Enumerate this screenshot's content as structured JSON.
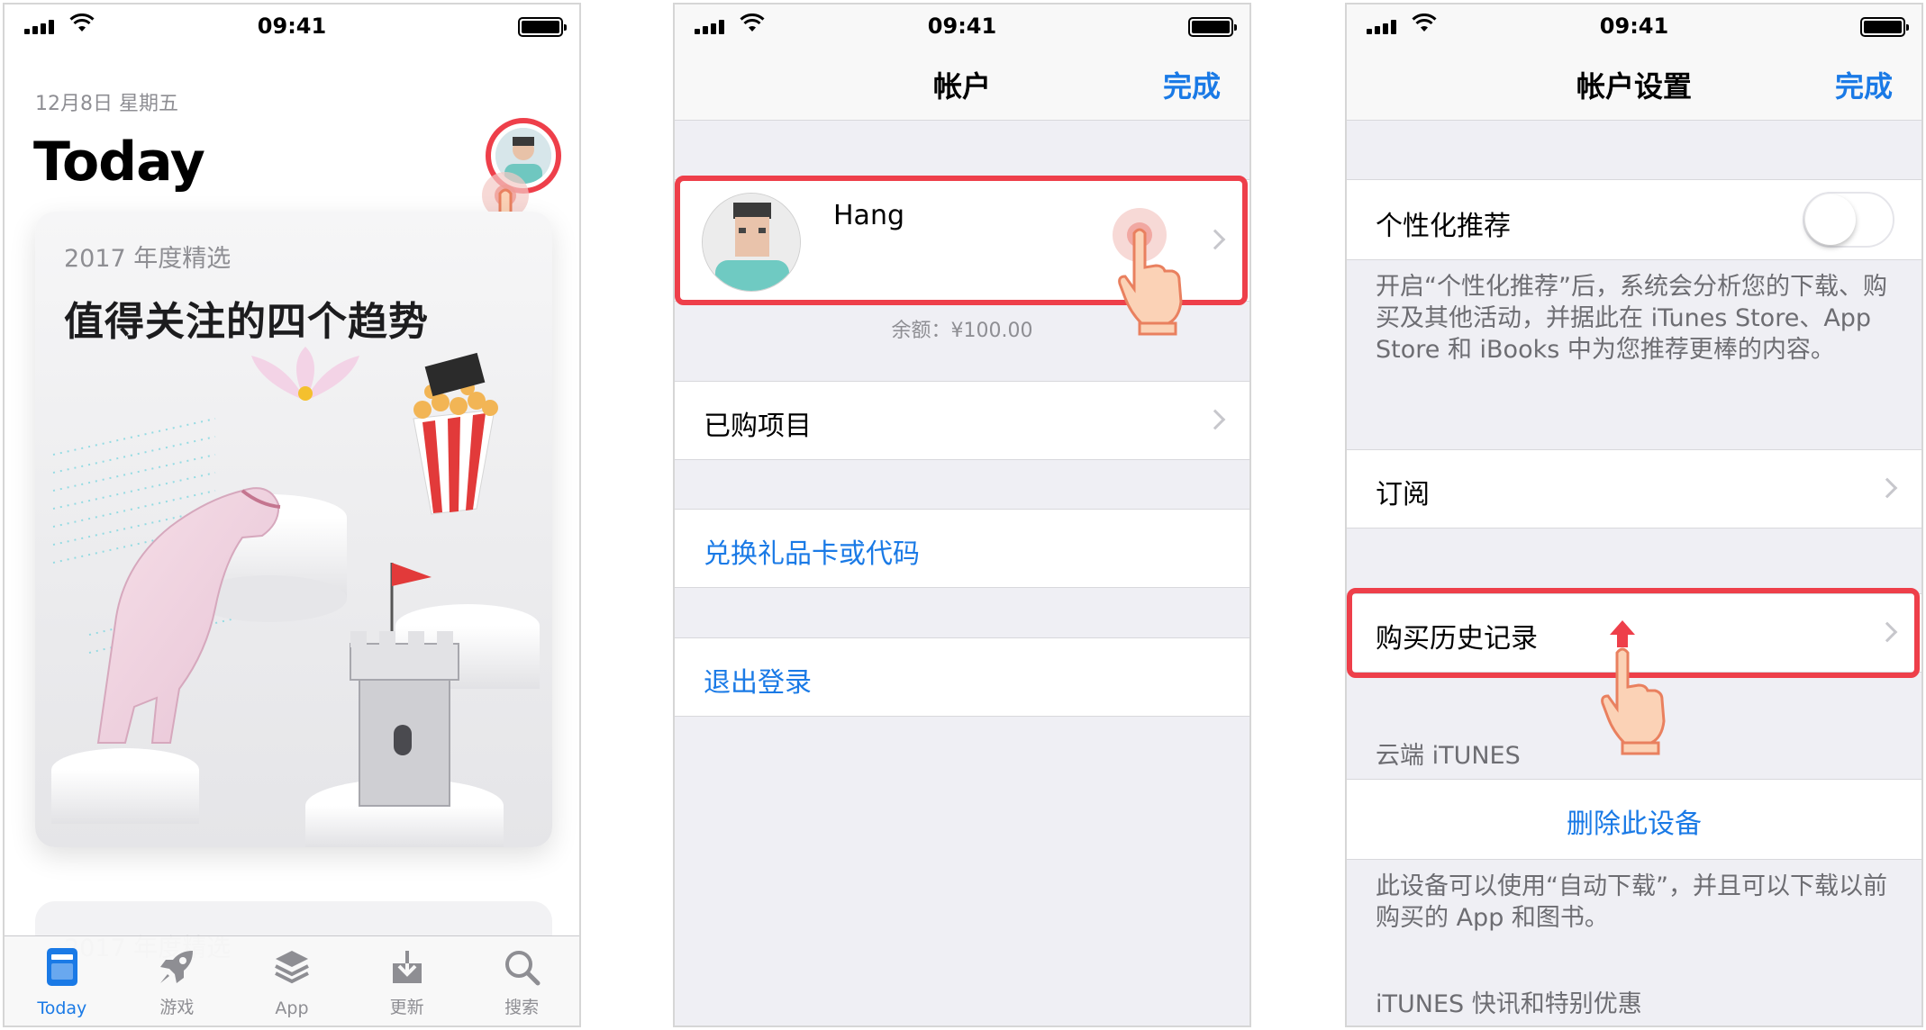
{
  "status_bar": {
    "time": "09:41"
  },
  "screen1": {
    "date": "12月8日 星期五",
    "title": "Today",
    "card": {
      "subtitle": "2017 年度精选",
      "title": "值得关注的四个趋势"
    },
    "card2": {
      "subtitle": "2017 年度精选"
    },
    "tabs": [
      {
        "label": "Today",
        "icon": "today-icon",
        "active": true
      },
      {
        "label": "游戏",
        "icon": "rocket-icon"
      },
      {
        "label": "App",
        "icon": "layers-icon"
      },
      {
        "label": "更新",
        "icon": "download-tray-icon"
      },
      {
        "label": "搜索",
        "icon": "search-icon"
      }
    ]
  },
  "screen2": {
    "nav": {
      "title": "帐户",
      "done": "完成"
    },
    "profile": {
      "name": "Hang",
      "balance": "余额：¥100.00"
    },
    "items": {
      "purchased": "已购项目",
      "redeem": "兑换礼品卡或代码",
      "signout": "退出登录"
    }
  },
  "screen3": {
    "nav": {
      "title": "帐户设置",
      "done": "完成"
    },
    "personalized": {
      "label": "个性化推荐",
      "on": false
    },
    "personalized_note": "开启“个性化推荐”后，系统会分析您的下载、购买及其他活动，并据此在 iTunes Store、App Store 和 iBooks 中为您推荐更棒的内容。",
    "subscriptions": "订阅",
    "purchase_history": "购买历史记录",
    "itunes_cloud_header": "云端 iTUNES",
    "remove_device": "删除此设备",
    "device_note": "此设备可以使用“自动下载”，并且可以下载以前购买的 App 和图书。",
    "news_header": "iTUNES 快讯和特别优惠"
  },
  "colors": {
    "accent": "#1a7ae6",
    "highlight": "#ee3f4a"
  }
}
